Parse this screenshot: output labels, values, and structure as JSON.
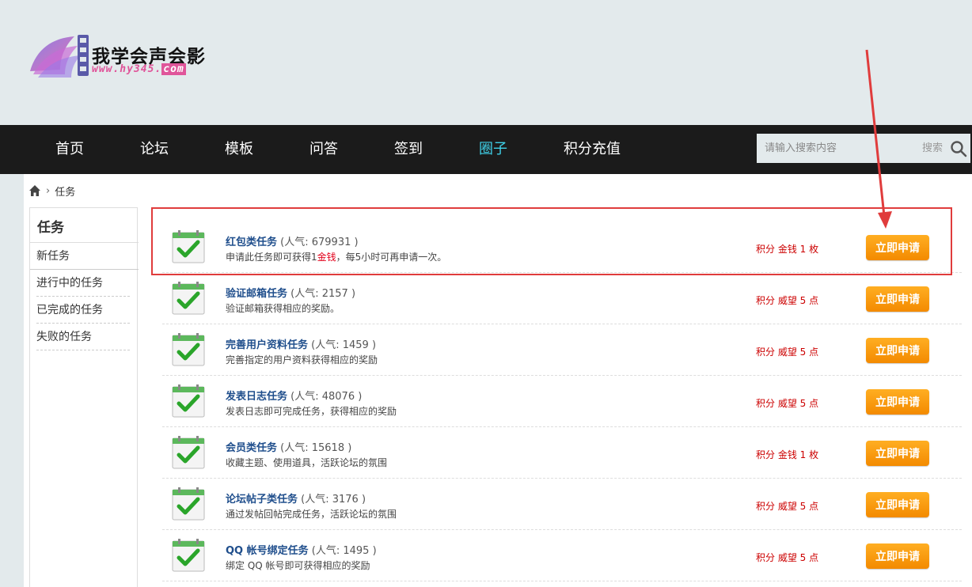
{
  "logo": {
    "title": "我学会声会影",
    "url_prefix": "www.hy345.",
    "url_suffix": "com"
  },
  "nav": {
    "items": [
      {
        "label": "首页"
      },
      {
        "label": "论坛"
      },
      {
        "label": "模板"
      },
      {
        "label": "问答"
      },
      {
        "label": "签到"
      },
      {
        "label": "圈子",
        "active": true
      },
      {
        "label": "积分充值"
      }
    ],
    "search_placeholder": "请输入搜索内容",
    "search_label": "搜索"
  },
  "breadcrumb": {
    "current": "任务"
  },
  "sidebar": {
    "title": "任务",
    "items": [
      {
        "label": "新任务",
        "active": true
      },
      {
        "label": "进行中的任务"
      },
      {
        "label": "已完成的任务"
      },
      {
        "label": "失败的任务"
      }
    ]
  },
  "tasks": [
    {
      "name": "红包类任务",
      "popularity": " (人气: 679931 )",
      "desc_pre": "申请此任务即可获得1",
      "desc_hl": "金钱",
      "desc_post": "，每5小时可再申请一次。",
      "reward": "积分 金钱 1 枚",
      "button": "立即申请"
    },
    {
      "name": "验证邮箱任务",
      "popularity": " (人气: 2157 )",
      "desc_pre": "验证邮箱获得相应的奖励。",
      "desc_hl": "",
      "desc_post": "",
      "reward": "积分 威望 5 点",
      "button": "立即申请"
    },
    {
      "name": "完善用户资料任务",
      "popularity": " (人气: 1459 )",
      "desc_pre": "完善指定的用户资料获得相应的奖励",
      "desc_hl": "",
      "desc_post": "",
      "reward": "积分 威望 5 点",
      "button": "立即申请"
    },
    {
      "name": "发表日志任务",
      "popularity": " (人气: 48076 )",
      "desc_pre": "发表日志即可完成任务，获得相应的奖励",
      "desc_hl": "",
      "desc_post": "",
      "reward": "积分 威望 5 点",
      "button": "立即申请"
    },
    {
      "name": "会员类任务",
      "popularity": " (人气: 15618 )",
      "desc_pre": "收藏主题、使用道具，活跃论坛的氛围",
      "desc_hl": "",
      "desc_post": "",
      "reward": "积分 金钱 1 枚",
      "button": "立即申请"
    },
    {
      "name": "论坛帖子类任务",
      "popularity": " (人气: 3176 )",
      "desc_pre": "通过发帖回帖完成任务，活跃论坛的氛围",
      "desc_hl": "",
      "desc_post": "",
      "reward": "积分 威望 5 点",
      "button": "立即申请"
    },
    {
      "name": "QQ 帐号绑定任务",
      "popularity": " (人气: 1495 )",
      "desc_pre": "绑定 QQ 帐号即可获得相应的奖励",
      "desc_hl": "",
      "desc_post": "",
      "reward": "积分 威望 5 点",
      "button": "立即申请"
    }
  ],
  "colors": {
    "nav_bg": "#1b1b1b",
    "nav_active": "#3fd0e8",
    "button": "#f39800",
    "annotation": "#e03c3c",
    "task_title": "#1f4e8c",
    "reward": "#cc0000"
  }
}
